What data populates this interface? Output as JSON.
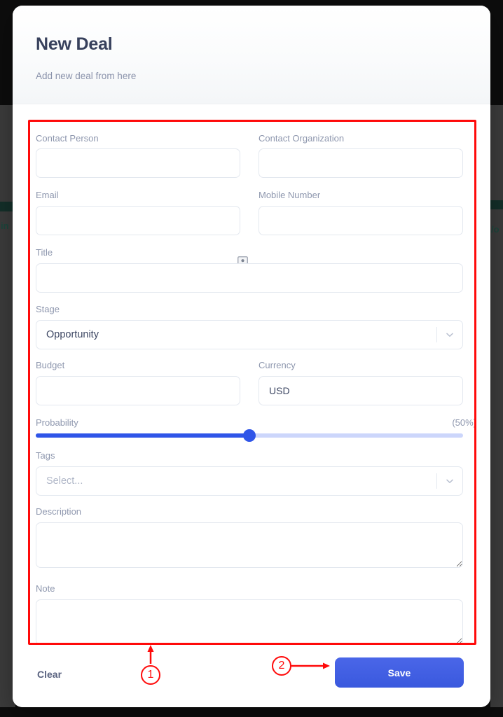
{
  "modal": {
    "title": "New Deal",
    "subtitle": "Add new deal from here"
  },
  "form": {
    "fields": [
      {
        "key": "contact_person",
        "label": "Contact Person",
        "type": "text",
        "value": "",
        "placeholder": ""
      },
      {
        "key": "contact_organization",
        "label": "Contact Organization",
        "type": "text",
        "value": "",
        "placeholder": ""
      },
      {
        "key": "email",
        "label": "Email",
        "type": "text",
        "value": "",
        "placeholder": ""
      },
      {
        "key": "mobile_number",
        "label": "Mobile Number",
        "type": "text",
        "value": "",
        "placeholder": ""
      },
      {
        "key": "title",
        "label": "Title",
        "type": "text",
        "value": "",
        "placeholder": ""
      },
      {
        "key": "stage",
        "label": "Stage",
        "type": "select",
        "value": "Opportunity"
      },
      {
        "key": "budget",
        "label": "Budget",
        "type": "text",
        "value": "",
        "placeholder": ""
      },
      {
        "key": "currency",
        "label": "Currency",
        "type": "text",
        "value": "USD",
        "placeholder": ""
      },
      {
        "key": "probability",
        "label": "Probability",
        "type": "slider",
        "value": 50,
        "value_label": "(50%)"
      },
      {
        "key": "tags",
        "label": "Tags",
        "type": "select",
        "value": "Select..."
      },
      {
        "key": "description",
        "label": "Description",
        "type": "textarea",
        "value": "",
        "placeholder": ""
      },
      {
        "key": "note",
        "label": "Note",
        "type": "textarea",
        "value": "",
        "placeholder": ""
      }
    ],
    "labels": {
      "contact_person": "Contact Person",
      "contact_organization": "Contact Organization",
      "email": "Email",
      "mobile_number": "Mobile Number",
      "title": "Title",
      "stage": "Stage",
      "budget": "Budget",
      "currency": "Currency",
      "probability": "Probability",
      "tags": "Tags",
      "description": "Description",
      "note": "Note"
    },
    "values": {
      "contact_person": "",
      "contact_organization": "",
      "email": "",
      "mobile_number": "",
      "title": "",
      "stage": "Opportunity",
      "budget": "",
      "currency": "USD",
      "probability": 50,
      "probability_label": "(50%)",
      "tags_placeholder": "Select...",
      "description": "",
      "note": ""
    },
    "icons": {
      "contact_lookup": "contact-card-icon",
      "stage_dropdown": "chevron-down-icon",
      "tags_dropdown": "chevron-down-icon"
    }
  },
  "footer": {
    "clear_label": "Clear",
    "save_label": "Save"
  },
  "annotations": {
    "marker_1": "1",
    "marker_2": "2",
    "color": "#ff0a0a"
  },
  "colors": {
    "accent": "#3b5bdb",
    "slider_fill": "#2f55e8",
    "slider_track": "#ccd6fb",
    "title": "#37405c",
    "label": "#8e97ae",
    "border": "#e3e8ef",
    "backdrop": "#0d0d0d"
  },
  "background": {
    "fragment_left": "in",
    "fragment_right": "/o"
  }
}
